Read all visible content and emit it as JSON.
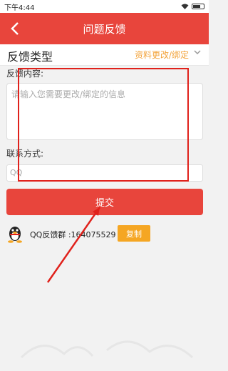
{
  "status_bar": {
    "time": "下午4:44"
  },
  "header": {
    "back_icon": "chevron-left-icon",
    "title": "问题反馈"
  },
  "feedback_type": {
    "label": "反馈类型",
    "value": "资料更改/绑定",
    "icon": "chevron-down-icon"
  },
  "content": {
    "label": "反馈内容:",
    "placeholder": "请输入您需要更改/绑定的信息"
  },
  "contact": {
    "label": "联系方式:",
    "placeholder": "QQ"
  },
  "submit": {
    "label": "提交"
  },
  "qq_group": {
    "icon": "qq-penguin-icon",
    "text": "QQ反馈群 :164075529",
    "copy_label": "复制"
  },
  "colors": {
    "accent": "#e8453c",
    "highlight": "#f3a33a",
    "annotation": "#e0211b"
  }
}
